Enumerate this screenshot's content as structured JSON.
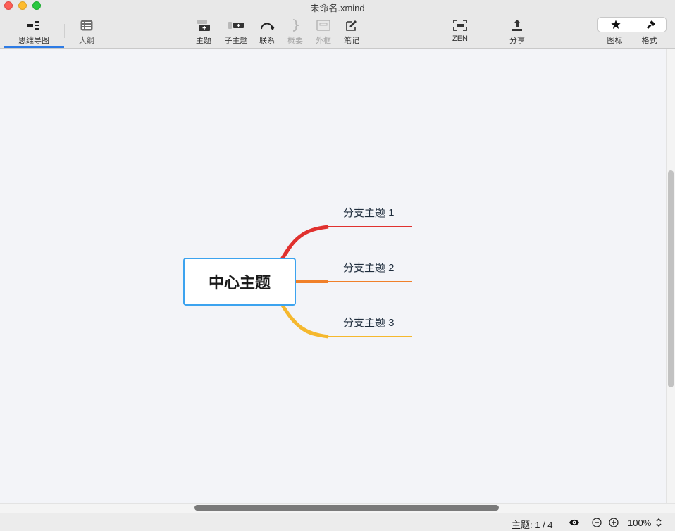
{
  "window": {
    "title": "未命名.xmind"
  },
  "toolbar": {
    "mindmap_label": "思维导图",
    "outline_label": "大纲",
    "topic_label": "主题",
    "subtopic_label": "子主题",
    "relationship_label": "联系",
    "summary_label": "概要",
    "boundary_label": "外框",
    "notes_label": "笔记",
    "zen_label": "ZEN",
    "share_label": "分享",
    "icons_label": "图标",
    "format_label": "格式"
  },
  "map": {
    "central_topic": "中心主题",
    "branches": [
      "分支主题 1",
      "分支主题 2",
      "分支主题 3"
    ],
    "branch_colors": [
      "#e0312f",
      "#f0802a",
      "#f5b82e"
    ],
    "central_border_color": "#3ca3ef"
  },
  "status": {
    "topic_count": "主题: 1 / 4",
    "zoom": "100%"
  }
}
